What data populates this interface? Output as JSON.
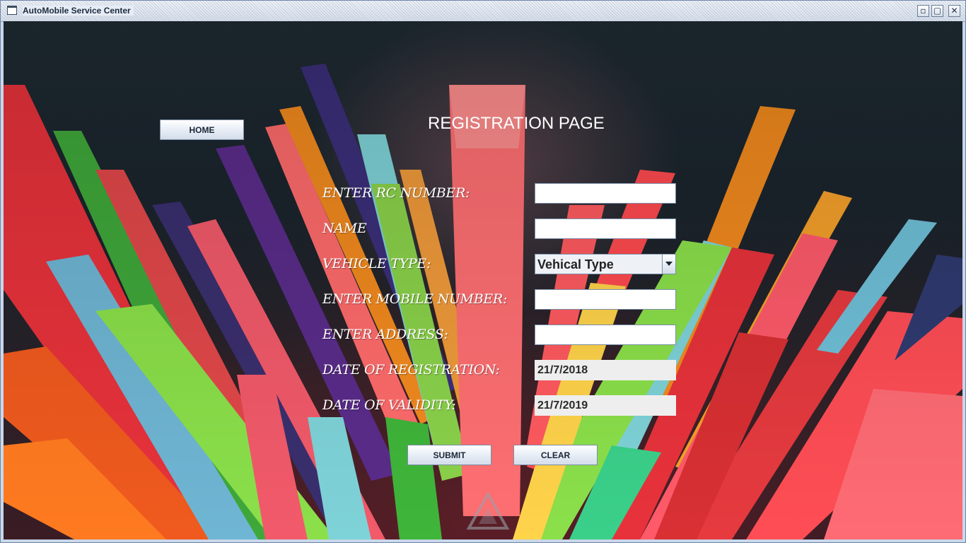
{
  "window": {
    "title": "AutoMobile Service Center",
    "controls": {
      "minimize_icon": "restore-down-icon",
      "maximize_icon": "maximize-icon",
      "close_icon": "close-icon"
    }
  },
  "nav": {
    "home_label": "HOME"
  },
  "form": {
    "title": "REGISTRATION PAGE",
    "fields": {
      "rc_number": {
        "label": "ENTER RC NUMBER:",
        "value": ""
      },
      "name": {
        "label": "NAME",
        "value": ""
      },
      "vehicle_type": {
        "label": "VEHICLE TYPE:",
        "selected": "Vehical Type"
      },
      "mobile_number": {
        "label": "ENTER MOBILE NUMBER:",
        "value": ""
      },
      "address": {
        "label": "ENTER ADDRESS:",
        "value": ""
      },
      "date_of_registration": {
        "label": "DATE OF REGISTRATION:",
        "value": "21/7/2018"
      },
      "date_of_validity": {
        "label": "DATE OF VALIDITY:",
        "value": "21/7/2019"
      }
    },
    "submit_label": "SUBMIT",
    "clear_label": "CLEAR"
  },
  "theme": {
    "background": "#1f2b33",
    "label_color": "#ffffff",
    "button_gradient": [
      "#ffffff",
      "#d3ddea"
    ]
  }
}
